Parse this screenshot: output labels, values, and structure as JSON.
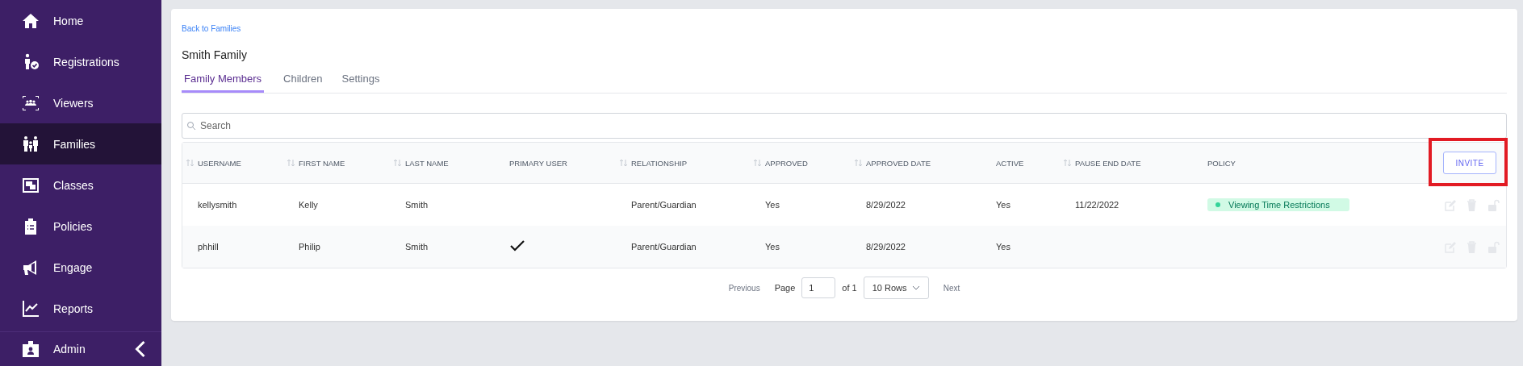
{
  "sidebar": {
    "items": [
      {
        "label": "Home",
        "selected": false
      },
      {
        "label": "Registrations",
        "selected": false
      },
      {
        "label": "Viewers",
        "selected": false
      },
      {
        "label": "Families",
        "selected": true
      },
      {
        "label": "Classes",
        "selected": false
      },
      {
        "label": "Policies",
        "selected": false
      },
      {
        "label": "Engage",
        "selected": false
      },
      {
        "label": "Reports",
        "selected": false
      }
    ],
    "footer": {
      "label": "Admin",
      "expanded": false
    }
  },
  "back_link": "Back to Families",
  "title": "Smith Family",
  "tabs": [
    {
      "label": "Family Members",
      "selected": true
    },
    {
      "label": "Children",
      "selected": false
    },
    {
      "label": "Settings",
      "selected": false
    }
  ],
  "search": {
    "placeholder": "Search"
  },
  "table": {
    "columns": [
      {
        "label": "USERNAME",
        "sortable": true
      },
      {
        "label": "FIRST NAME",
        "sortable": true
      },
      {
        "label": "LAST NAME",
        "sortable": true
      },
      {
        "label": "PRIMARY USER",
        "sortable": false
      },
      {
        "label": "RELATIONSHIP",
        "sortable": true
      },
      {
        "label": "APPROVED",
        "sortable": true
      },
      {
        "label": "APPROVED DATE",
        "sortable": true
      },
      {
        "label": "ACTIVE",
        "sortable": false
      },
      {
        "label": "PAUSE END DATE",
        "sortable": true
      },
      {
        "label": "POLICY",
        "sortable": false
      }
    ],
    "invite_button": {
      "label": "INVITE",
      "highlighted": true
    },
    "rows": [
      {
        "username": "kellysmith",
        "first_name": "Kelly",
        "last_name": "Smith",
        "relationship": "Parent/Guardian",
        "approved": "Yes",
        "approved_date": "8/29/2022",
        "active": "Yes",
        "pause_end_date": "11/22/2022",
        "policy": {
          "label": "Viewing Time Restrictions",
          "color": "#34d399"
        },
        "actions": [
          {
            "kind": "edit",
            "disabled": true
          },
          {
            "kind": "delete",
            "disabled": true
          },
          {
            "kind": "unlock",
            "disabled": true
          }
        ]
      },
      {
        "username": "phhill",
        "first_name": "Philip",
        "last_name": "Smith",
        "primary_user": true,
        "relationship": "Parent/Guardian",
        "approved": "Yes",
        "approved_date": "8/29/2022",
        "active": "Yes",
        "actions": [
          {
            "kind": "edit",
            "disabled": true
          },
          {
            "kind": "delete",
            "disabled": true
          },
          {
            "kind": "unlock",
            "disabled": true
          }
        ]
      }
    ]
  },
  "pagination": {
    "previous": "Previous",
    "page_label": "Page",
    "page": "1",
    "of_label": "of 1",
    "rows_select": "10 Rows",
    "next": "Next"
  }
}
